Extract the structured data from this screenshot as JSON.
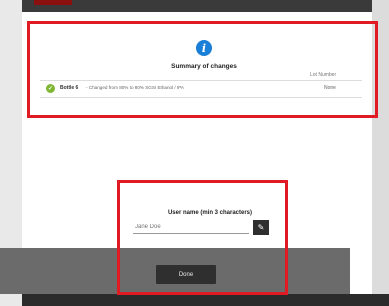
{
  "summary": {
    "title": "Summary of changes",
    "lot_number_header": "Lot Number",
    "rows": [
      {
        "bottle": "Bottle 6",
        "change": "-  Changed from 80% to 80% SGSI Ethanol / IPA",
        "lot": "None"
      }
    ]
  },
  "user": {
    "label": "User name (min 3 characters)",
    "placeholder": "Jane Doe"
  },
  "footer": {
    "done_label": "Done"
  },
  "icons": {
    "info": "info-icon",
    "row_status": "check-circle-icon",
    "edit": "pencil-icon"
  },
  "colors": {
    "info_blue": "#1a7fd6",
    "check_green": "#7fb734",
    "highlight_red": "#e01b24",
    "footer_gray": "#6b6b6b",
    "button_dark": "#2f2f2f"
  }
}
